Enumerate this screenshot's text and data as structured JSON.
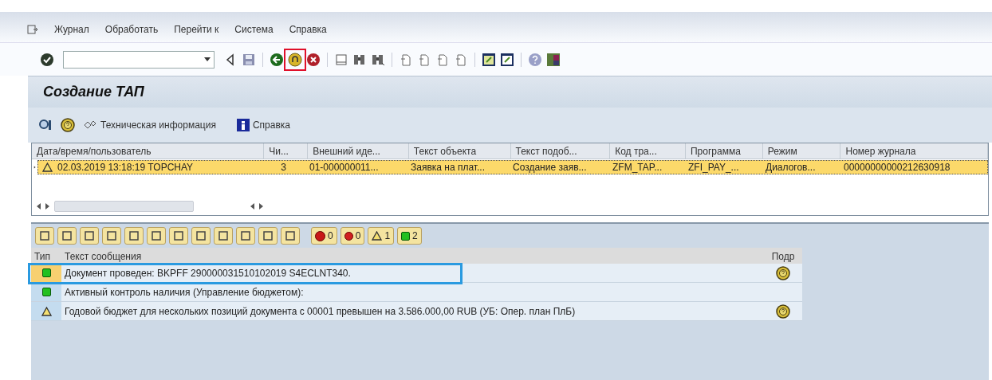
{
  "menu": [
    "Журнал",
    "Обработать",
    "Перейти к",
    "Система",
    "Справка"
  ],
  "toolbar": [
    {
      "kind": "enter",
      "highlighted": false
    },
    {
      "kind": "command",
      "highlighted": false
    },
    {
      "kind": "back_small",
      "highlighted": false
    },
    {
      "kind": "save",
      "highlighted": false
    },
    {
      "kind": "separator"
    },
    {
      "kind": "back",
      "highlighted": false
    },
    {
      "kind": "exit",
      "highlighted": true
    },
    {
      "kind": "cancel",
      "highlighted": false
    },
    {
      "kind": "separator"
    },
    {
      "kind": "print",
      "highlighted": false
    },
    {
      "kind": "find",
      "highlighted": false
    },
    {
      "kind": "find_next",
      "highlighted": false
    },
    {
      "kind": "separator"
    },
    {
      "kind": "page",
      "highlighted": false
    },
    {
      "kind": "page",
      "highlighted": false
    },
    {
      "kind": "page",
      "highlighted": false
    },
    {
      "kind": "page",
      "highlighted": false
    },
    {
      "kind": "separator"
    },
    {
      "kind": "session",
      "highlighted": false
    },
    {
      "kind": "shortcut",
      "highlighted": false
    },
    {
      "kind": "separator"
    },
    {
      "kind": "help",
      "highlighted": false
    },
    {
      "kind": "layout",
      "highlighted": false
    }
  ],
  "title": "Создание ТАП",
  "app_toolbar": [
    {
      "kind": "detail"
    },
    {
      "kind": "hint"
    },
    {
      "kind": "tech",
      "label": "Техническая информация"
    },
    {
      "kind": "info",
      "label": "Справка"
    }
  ],
  "log_table": {
    "columns": [
      "Дата/время/пользователь",
      "Чи...",
      "Внешний иде...",
      "Текст объекта",
      "Текст подоб...",
      "Код тра...",
      "Программа",
      "Режим",
      "Номер журнала"
    ],
    "rows": [
      {
        "kind": "warning",
        "selected": true,
        "expanded": false,
        "cells": [
          "02.03.2019  13:18:19  TOPCHAY",
          "3",
          "01-000000011...",
          "Заявка на плат...",
          "Создание заяв...",
          "ZFM_TAP...",
          "ZFI_PAY_...",
          "Диалогов...",
          "00000000000212630918"
        ]
      }
    ]
  },
  "alv_toolbar": [
    {
      "kind": "tool"
    },
    {
      "kind": "tool"
    },
    {
      "kind": "tool"
    },
    {
      "kind": "tool"
    },
    {
      "kind": "tool"
    },
    {
      "kind": "tool"
    },
    {
      "kind": "tool"
    },
    {
      "kind": "tool"
    },
    {
      "kind": "tool"
    },
    {
      "kind": "tool"
    },
    {
      "kind": "tool"
    },
    {
      "kind": "tool"
    }
  ],
  "counters": [
    {
      "kind": "stop",
      "count": "0"
    },
    {
      "kind": "error",
      "count": "0"
    },
    {
      "kind": "warning",
      "count": "1"
    },
    {
      "kind": "success",
      "count": "2"
    }
  ],
  "messages": {
    "highlighted": true,
    "columns": [
      "Тип",
      "Текст сообщения",
      "Подр"
    ],
    "rows": [
      {
        "kind": "success",
        "selected": true,
        "detail": true,
        "text": "Документ проведен: BKPFF 290000031510102019 S4ECLNT340."
      },
      {
        "kind": "success",
        "selected": false,
        "detail": false,
        "text": "Активный контроль наличия (Управление бюджетом):"
      },
      {
        "kind": "warning",
        "selected": false,
        "detail": true,
        "text": "Годовой бюджет для нескольких позиций документа с 00001 превышен на 3.586.000,00 RUB (УБ: Опер. план ПлБ)"
      }
    ]
  }
}
